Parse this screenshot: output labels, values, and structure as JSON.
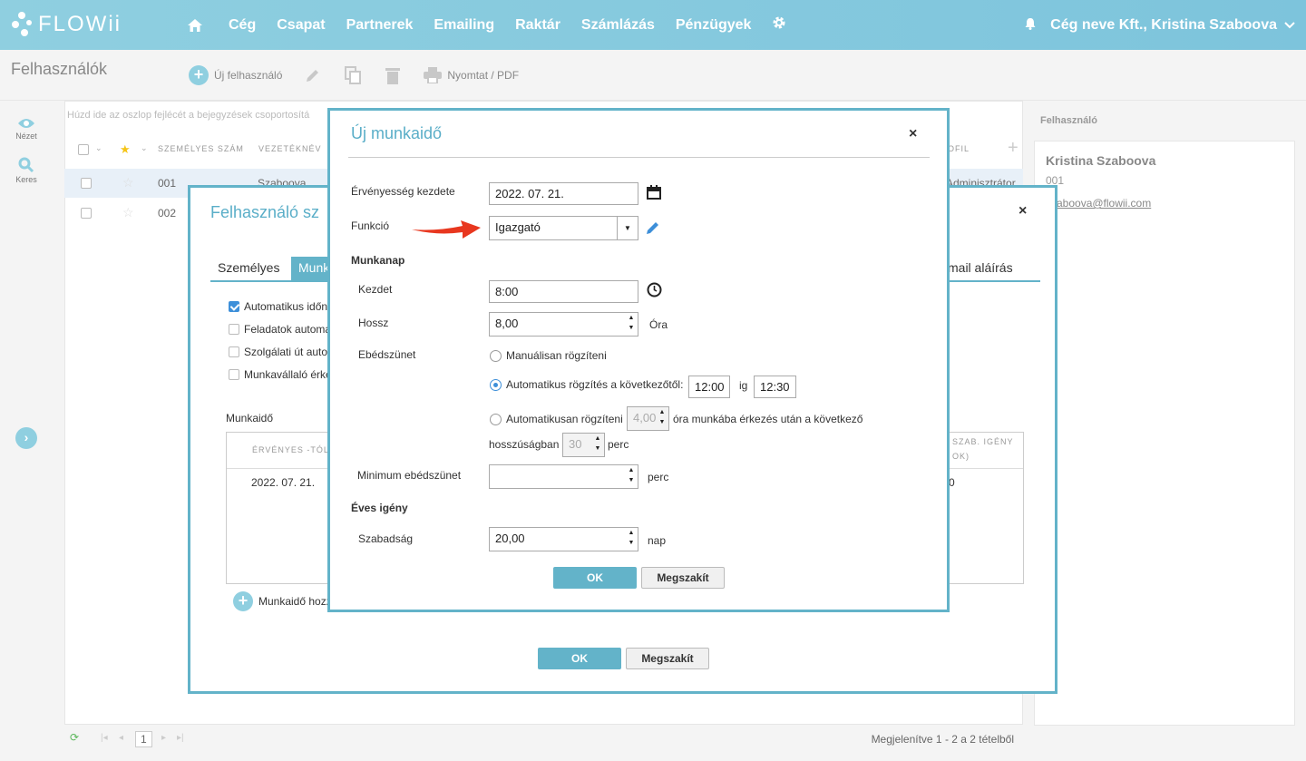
{
  "app": {
    "logo": "FLOWii"
  },
  "nav": {
    "items": [
      "Cég",
      "Csapat",
      "Partnerek",
      "Emailing",
      "Raktár",
      "Számlázás",
      "Pénzügyek"
    ],
    "company_user": "Cég neve Kft., Kristina Szaboova"
  },
  "page": {
    "title": "Felhasználók"
  },
  "toolbar": {
    "new_user": "Új felhasználó",
    "print": "Nyomtat / PDF"
  },
  "rail": {
    "view": "Nézet",
    "search": "Keres"
  },
  "grid": {
    "group_hint": "Húzd ide az oszlop fejlécét a bejegyzések csoportosítá",
    "headers": [
      "SZEMÉLYES SZÁM",
      "VEZETÉKNÉV",
      "OFIL"
    ],
    "rows": [
      {
        "num": "001",
        "last": "Szaboova",
        "role": "Adminisztrátor"
      },
      {
        "num": "002",
        "last": "",
        "role": ""
      }
    ],
    "footer": {
      "page": "1",
      "summary": "Megjelenítve 1 - 2 a 2 tételből"
    }
  },
  "right_panel": {
    "heading": "Felhasználó",
    "name": "Kristina Szaboova",
    "num": "001",
    "email": "szaboova@flowii.com"
  },
  "modal_user": {
    "title": "Felhasználó sz",
    "tabs": [
      "Személyes",
      "Munk",
      "mail aláírás"
    ],
    "checks": [
      {
        "label": "Automatikus időn",
        "checked": true
      },
      {
        "label": "Feladatok automa",
        "checked": false
      },
      {
        "label": "Szolgálati út auto",
        "checked": false
      },
      {
        "label": "Munkavállaló érke",
        "checked": false
      }
    ],
    "worktime_label": "Munkaidő",
    "table_header_from": "ÉRVÉNYES -TÓL",
    "table_header_right": "SZAB. IGÉNY",
    "table_header_right2": "OK)",
    "table_row_date": "2022. 07. 21.",
    "table_row_right": "0",
    "add_worktime": "Munkaidő hozz",
    "ok": "OK",
    "cancel": "Megszakít"
  },
  "modal_worktime": {
    "title": "Új munkaidő",
    "validity_label": "Érvényesség kezdete",
    "validity_value": "2022. 07. 21.",
    "function_label": "Funkció",
    "function_value": "Igazgató",
    "workday_label": "Munkanap",
    "start_label": "Kezdet",
    "start_value": "8:00",
    "length_label": "Hossz",
    "length_value": "8,00",
    "length_unit": "Óra",
    "lunch_label": "Ebédszünet",
    "lunch_manual": "Manuálisan rögzíteni",
    "lunch_auto_from": "Automatikus rögzítés a következőtől:",
    "lunch_from": "12:00",
    "lunch_to_word": "ig",
    "lunch_to": "12:30",
    "lunch_auto_after": "Automatikusan rögzíteni",
    "lunch_after_hours": "4,00",
    "lunch_after_text": "óra munkába érkezés után a következő",
    "lunch_length_word": "hosszúságban",
    "lunch_length": "30",
    "lunch_length_unit": "perc",
    "min_lunch_label": "Minimum ebédszünet",
    "min_lunch_unit": "perc",
    "annual_label": "Éves igény",
    "holiday_label": "Szabadság",
    "holiday_value": "20,00",
    "holiday_unit": "nap",
    "ok": "OK",
    "cancel": "Megszakít"
  },
  "colors": {
    "accent": "#63b3c9",
    "arrow": "#e8371f"
  }
}
